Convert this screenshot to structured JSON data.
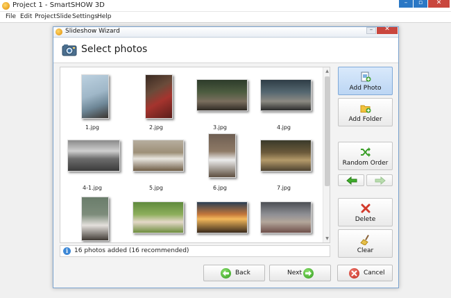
{
  "app": {
    "title": "Project 1 - SmartSHOW 3D",
    "menu": [
      "File",
      "Edit",
      "Project",
      "Slide",
      "Settings",
      "Help"
    ]
  },
  "dialog": {
    "title": "Slideshow Wizard",
    "header": "Select photos",
    "photos": [
      {
        "name": "1.jpg"
      },
      {
        "name": "2.jpg"
      },
      {
        "name": "3.jpg"
      },
      {
        "name": "4.jpg"
      },
      {
        "name": "4-1.jpg"
      },
      {
        "name": "5.jpg"
      },
      {
        "name": "6.jpg"
      },
      {
        "name": "7.jpg"
      },
      {
        "name": ""
      },
      {
        "name": ""
      },
      {
        "name": ""
      },
      {
        "name": ""
      }
    ],
    "side_buttons": {
      "add_photo": "Add Photo",
      "add_folder": "Add Folder",
      "random_order": "Random Order",
      "delete": "Delete",
      "clear": "Clear"
    },
    "status": "16 photos added (16 recommended)",
    "nav": {
      "back": "Back",
      "next": "Next",
      "cancel": "Cancel"
    }
  },
  "colors": {
    "accent": "#2b78c5",
    "active_button": "#bcd6f4",
    "go_green": "#2f9b1b",
    "cancel_red": "#c1281c"
  }
}
